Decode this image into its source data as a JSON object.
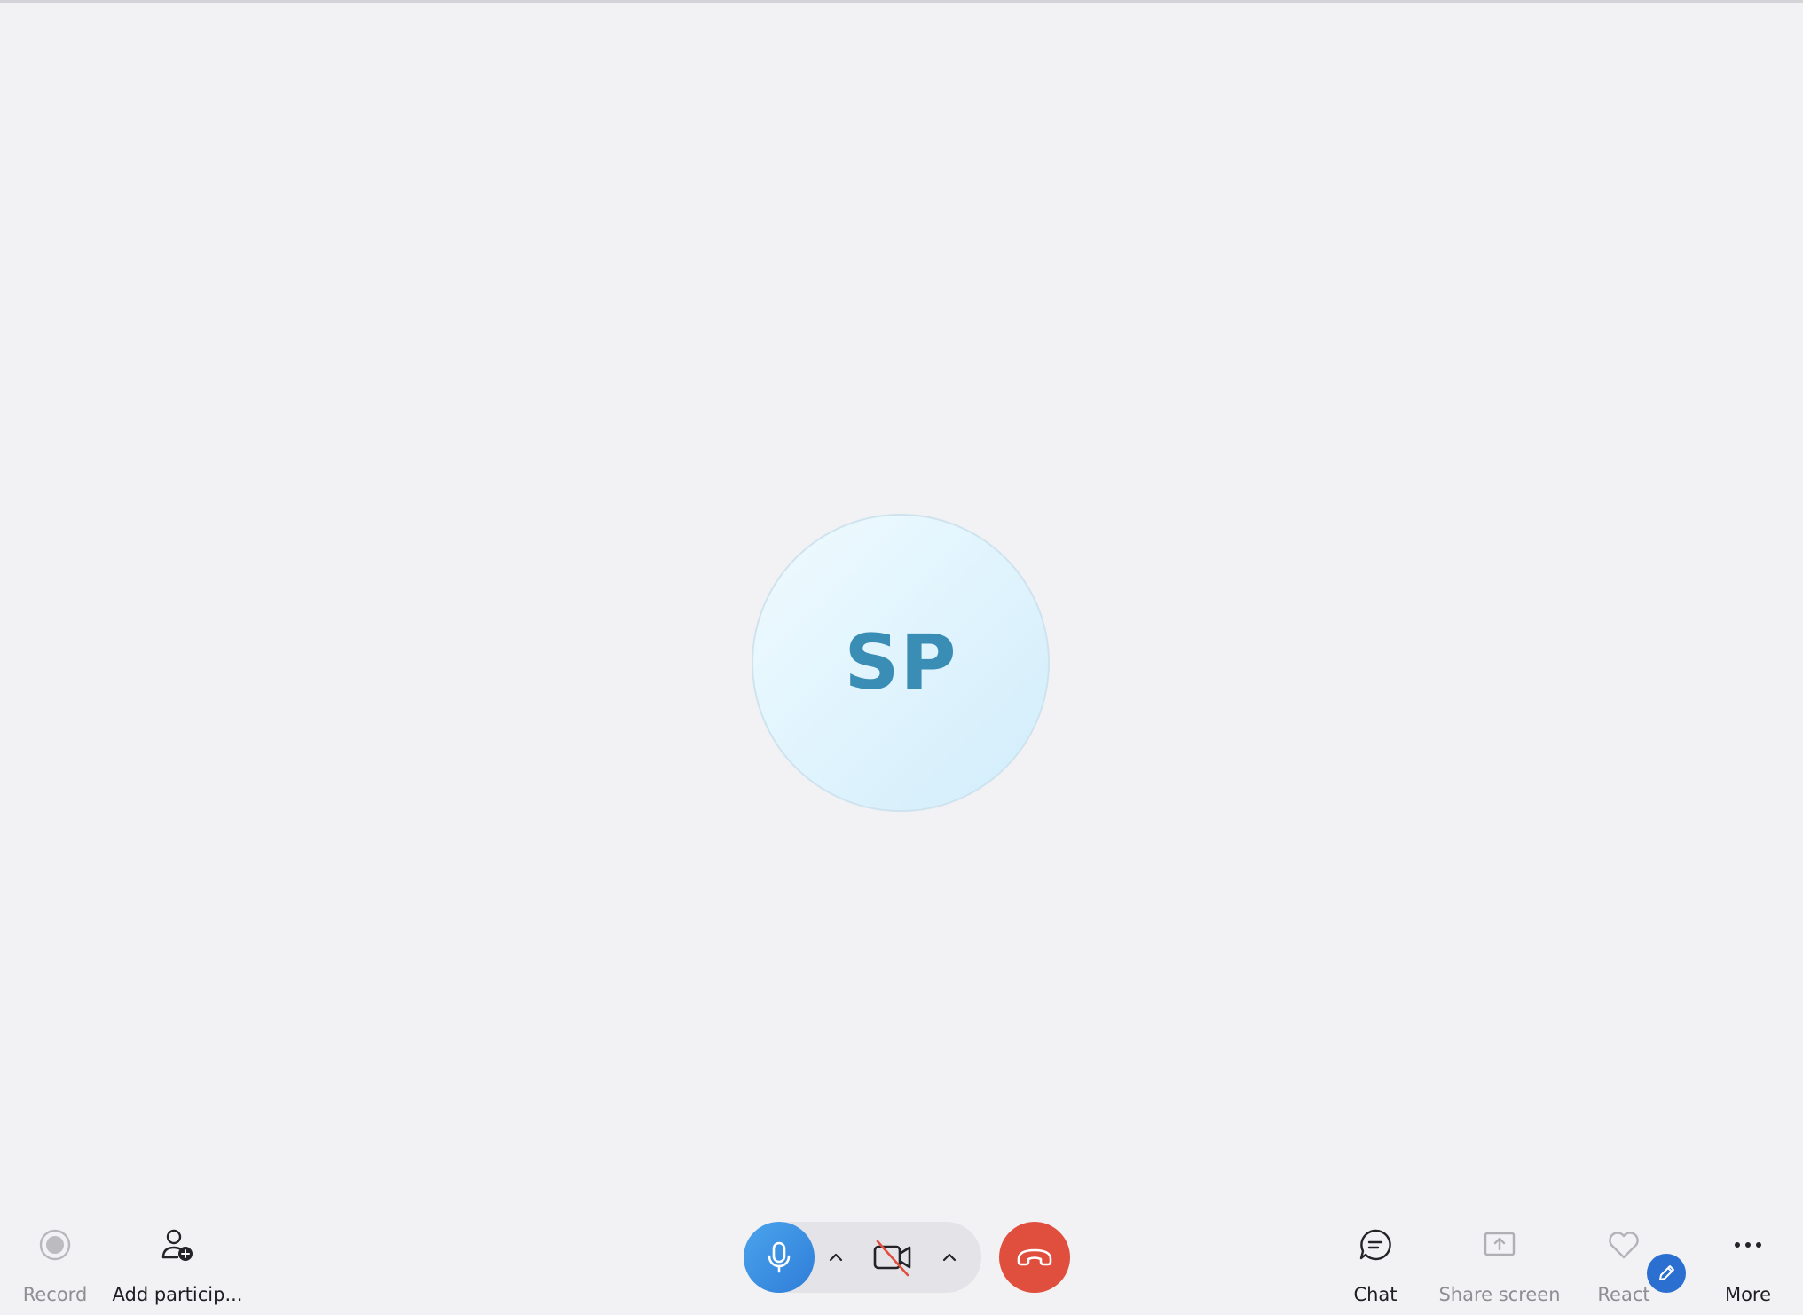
{
  "participant": {
    "initials": "SP"
  },
  "toolbar": {
    "record": {
      "label": "Record",
      "icon": "record-icon"
    },
    "add_participants": {
      "label": "Add particip...",
      "icon": "person-add-icon"
    },
    "chat": {
      "label": "Chat",
      "icon": "chat-icon"
    },
    "share_screen": {
      "label": "Share screen",
      "icon": "share-screen-icon"
    },
    "react": {
      "label": "React",
      "icon": "heart-icon"
    },
    "more": {
      "label": "More",
      "icon": "more-dots-icon"
    }
  },
  "call_controls": {
    "mic": {
      "icon": "microphone-icon",
      "state": "on"
    },
    "camera": {
      "icon": "camera-off-icon",
      "state": "off"
    },
    "hangup": {
      "icon": "hang-up-icon"
    }
  },
  "colors": {
    "background": "#f2f2f4",
    "accent": "#2f7dd8",
    "hangup": "#e04e3d",
    "avatar_text": "#3a8db5"
  }
}
